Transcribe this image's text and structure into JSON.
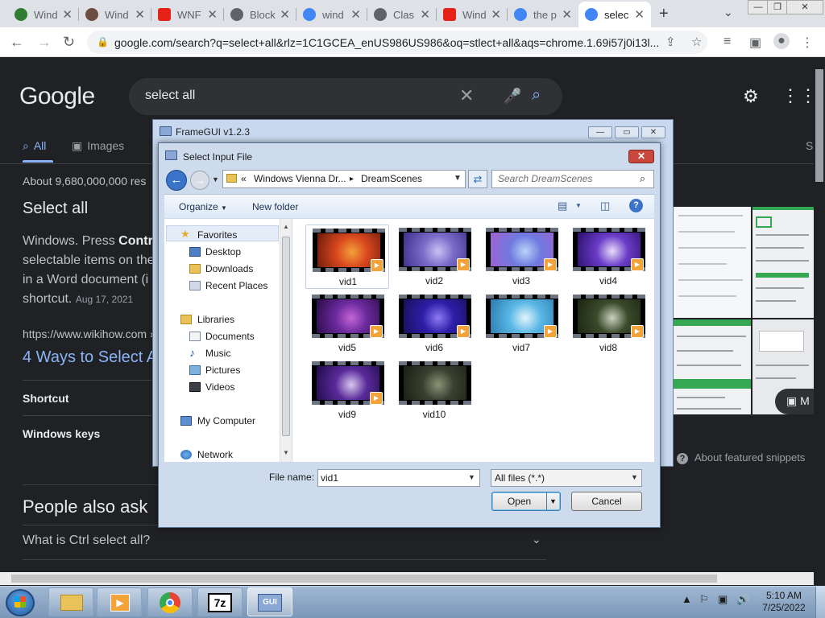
{
  "browser": {
    "tabs": [
      {
        "title": "Wind",
        "favicon_color": "#2e7d32"
      },
      {
        "title": "Wind",
        "favicon_color": "#6d4c41"
      },
      {
        "title": "WNF",
        "favicon_color": "#e62117"
      },
      {
        "title": "Block",
        "favicon_color": "#5f6368"
      },
      {
        "title": "wind",
        "favicon_color": "#4285f4"
      },
      {
        "title": "Clas",
        "favicon_color": "#5f6368"
      },
      {
        "title": "Wind",
        "favicon_color": "#e62117"
      },
      {
        "title": "the p",
        "favicon_color": "#4285f4"
      },
      {
        "title": "selec",
        "favicon_color": "#4285f4"
      }
    ],
    "url": "google.com/search?q=select+all&rlz=1C1GCEA_enUS986US986&oq=stlect+all&aqs=chrome.1.69i57j0i13l..."
  },
  "google": {
    "logo": "Google",
    "query": "select all",
    "nav_tabs": [
      "All",
      "Images"
    ],
    "nav_tab_partial_right": "S",
    "result_count": "About 9,680,000,000 res",
    "snippet_title": "Select all",
    "snippet_line1_a": "Windows. Press ",
    "snippet_line1_b": "Contro",
    "snippet_line2": "selectable items on the",
    "snippet_line3": "in a Word document (i",
    "snippet_line4": "shortcut.",
    "snippet_date": "Aug 17, 2021",
    "source_url": "https://www.wikihow.com",
    "source_url_tail": "›",
    "result_link": "4 Ways to Select A",
    "section1": "Shortcut",
    "section2": "Windows keys",
    "about_snippets": "About featured snippets",
    "more_button": "M",
    "people_also_ask": "People also ask",
    "paa_q1": "What is Ctrl select all?"
  },
  "framegui": {
    "title": "FrameGUI v1.2.3"
  },
  "dialog": {
    "title": "Select Input File",
    "breadcrumb_chevrons": "«",
    "breadcrumb_1": "Windows Vienna Dr...",
    "breadcrumb_sep": "▸",
    "breadcrumb_2": "DreamScenes",
    "search_placeholder": "Search DreamScenes",
    "organize": "Organize",
    "new_folder": "New folder",
    "nav": {
      "favorites": "Favorites",
      "desktop": "Desktop",
      "downloads": "Downloads",
      "recent": "Recent Places",
      "libraries": "Libraries",
      "documents": "Documents",
      "music": "Music",
      "pictures": "Pictures",
      "videos": "Videos",
      "computer": "My Computer",
      "network": "Network"
    },
    "files": [
      {
        "name": "vid1",
        "c1": "#d9481e",
        "c2": "#f3a23a",
        "c3": "#6b1a0a"
      },
      {
        "name": "vid2",
        "c1": "#7a6ac9",
        "c2": "#c9c2f0",
        "c3": "#3b2f8a"
      },
      {
        "name": "vid3",
        "c1": "#6f7be0",
        "c2": "#b9d3f7",
        "c3": "#a25fd0"
      },
      {
        "name": "vid4",
        "c1": "#6a3cc7",
        "c2": "#e8dcfa",
        "c3": "#2a0f6b"
      },
      {
        "name": "vid5",
        "c1": "#6b2a9e",
        "c2": "#c565d6",
        "c3": "#2a0a46"
      },
      {
        "name": "vid6",
        "c1": "#2d1ea8",
        "c2": "#8f7af2",
        "c3": "#1a0f5a"
      },
      {
        "name": "vid7",
        "c1": "#5ab8e6",
        "c2": "#e6f4fb",
        "c3": "#2a7ab0"
      },
      {
        "name": "vid8",
        "c1": "#3a4a2a",
        "c2": "#c9d2c0",
        "c3": "#1a2410"
      },
      {
        "name": "vid9",
        "c1": "#5a2a9a",
        "c2": "#d9c7f0",
        "c3": "#1e0a4a"
      },
      {
        "name": "vid10",
        "c1": "#3a4030",
        "c2": "#8a9478",
        "c3": "#1a1e14"
      }
    ],
    "filename_label": "File name:",
    "filename_value": "vid1",
    "filetype_value": "All files (*.*)",
    "open_button": "Open",
    "cancel_button": "Cancel"
  },
  "taskbar": {
    "time": "5:10 AM",
    "date": "7/25/2022",
    "gui_label": "GUI",
    "sevenzip_label": "7z"
  }
}
